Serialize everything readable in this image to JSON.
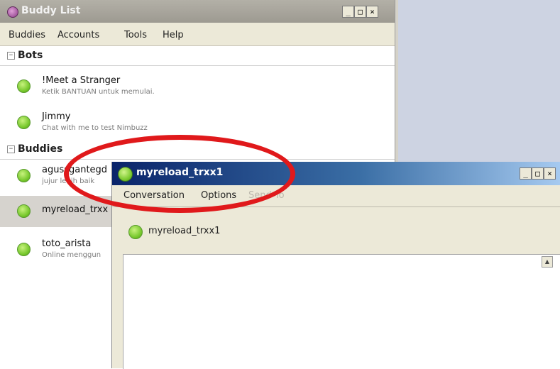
{
  "buddy_list": {
    "title": "Buddy List",
    "menu": [
      "Buddies",
      "Accounts",
      "Tools",
      "Help"
    ],
    "groups": [
      {
        "label": "Bots",
        "toggle": "−",
        "buddies": [
          {
            "name": "!Meet a Stranger",
            "status": "Ketik BANTUAN untuk memulai."
          },
          {
            "name": "Jimmy",
            "status": "Chat with me to test Nimbuzz"
          }
        ]
      },
      {
        "label": "Buddies",
        "toggle": "−",
        "buddies": [
          {
            "name": "agussgantegd",
            "status": "jujur lebih baik"
          },
          {
            "name": "myreload_trxx",
            "status": ""
          },
          {
            "name": "toto_arista",
            "status": "Online menggun"
          }
        ]
      }
    ]
  },
  "conversation": {
    "title": "myreload_trxx1",
    "menu": [
      "Conversation",
      "Options",
      "Send To"
    ],
    "header_name": "myreload_trxx1",
    "scroll_up_glyph": "▲"
  },
  "window_buttons": {
    "minimize": "_",
    "maximize": "□",
    "close": "×"
  },
  "colors": {
    "status_online": "#74c62a",
    "annotation": "#e0191b",
    "active_title_start": "#0a246a",
    "inactive_title": "#a8a59c"
  },
  "icons": {
    "app": "pidgin-app-icon",
    "status": "online-status-icon",
    "scroll": "scroll-up-arrow-icon"
  }
}
